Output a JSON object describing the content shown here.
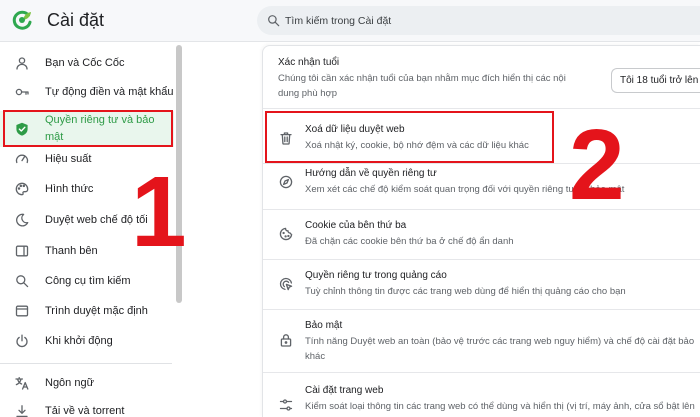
{
  "app": {
    "title": "Cài đặt",
    "logo_icon": "coccoc-logo-icon",
    "accent_color": "#2e9b47"
  },
  "search": {
    "placeholder": "Tìm kiếm trong Cài đặt",
    "icon": "search-icon"
  },
  "sidebar": {
    "selected_index": 2,
    "items": [
      {
        "label": "Bạn và Cốc Cốc",
        "icon": "user-icon"
      },
      {
        "label": "Tự động điền và mật khẩu",
        "icon": "key-icon"
      },
      {
        "label": "Quyền riêng tư và bảo mật",
        "icon": "shield-icon"
      },
      {
        "label": "Hiệu suất",
        "icon": "performance-icon"
      },
      {
        "label": "Hình thức",
        "icon": "palette-icon"
      },
      {
        "label": "Duyệt web chế độ tối",
        "icon": "moon-icon"
      },
      {
        "label": "Thanh bên",
        "icon": "sidebar-panel-icon"
      },
      {
        "label": "Công cụ tìm kiếm",
        "icon": "search-icon"
      },
      {
        "label": "Trình duyệt mặc định",
        "icon": "browser-icon"
      },
      {
        "label": "Khi khởi động",
        "icon": "power-icon"
      },
      {
        "label": "Ngôn ngữ",
        "icon": "translate-icon"
      },
      {
        "label": "Tải về và torrent",
        "icon": "download-icon"
      }
    ]
  },
  "main": {
    "age_verification": {
      "title": "Xác nhận tuổi",
      "description_lines": [
        "Chúng tôi cần xác nhận tuổi của bạn nhằm mục đích hiển thị các nội",
        "dung phù hợp"
      ],
      "select_value": "Tôi 18 tuổi trở lên"
    },
    "rows": [
      {
        "title": "Xoá dữ liệu duyệt web",
        "description": "Xoá nhật ký, cookie, bộ nhớ đệm và các dữ liệu khác",
        "icon": "trash-icon"
      },
      {
        "title": "Hướng dẫn về quyền riêng tư",
        "description": "Xem xét các chế độ kiểm soát quan trọng đối với quyền riêng tư và bảo mật",
        "icon": "privacy-guide-icon"
      },
      {
        "title": "Cookie của bên thứ ba",
        "description": "Đã chặn các cookie bên thứ ba ở chế độ ẩn danh",
        "icon": "cookie-icon"
      },
      {
        "title": "Quyền riêng tư trong quảng cáo",
        "description": "Tuỳ chỉnh thông tin được các trang web dùng để hiển thị quảng cáo cho bạn",
        "icon": "ad-privacy-icon"
      },
      {
        "title": "Bảo mật",
        "description_lines": [
          "Tính năng Duyệt web an toàn (bảo vệ trước các trang web nguy hiểm) và chế độ cài đặt bảo",
          "khác"
        ],
        "icon": "lock-icon"
      },
      {
        "title": "Cài đặt trang web",
        "description": "Kiểm soát loại thông tin các trang web có thể dùng và hiển thị (vị trí, máy ảnh, cửa sổ bật lên",
        "icon": "site-settings-icon"
      }
    ]
  },
  "annotations": {
    "marker_1": "1",
    "marker_2": "2",
    "color": "#e4141b"
  }
}
